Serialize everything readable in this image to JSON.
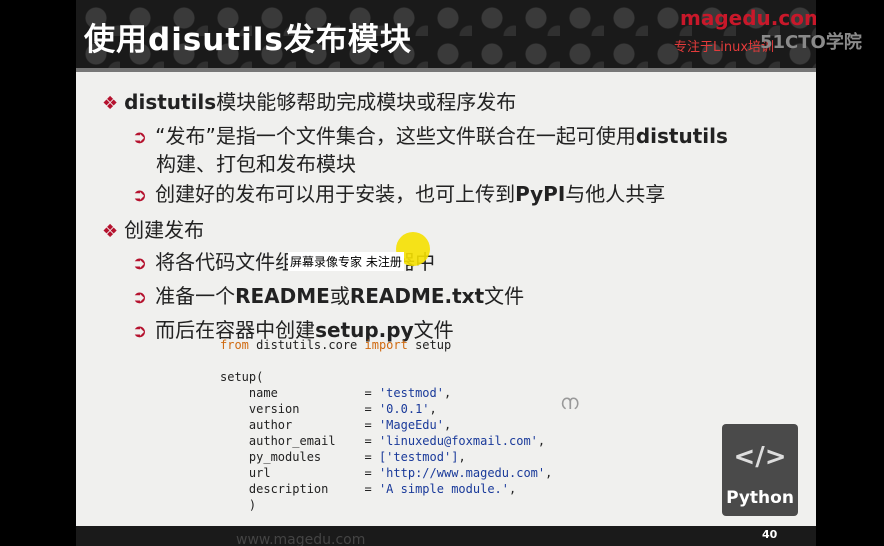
{
  "slide": {
    "title": "使用disutils发布模块",
    "logo": "magedu.com",
    "logo_tagline": "专注于Linux培训",
    "watermark_51cto": "51CTO学院",
    "page_number": "40",
    "footer_url": "www.magedu.com"
  },
  "bullets": [
    {
      "level": 1,
      "parts": [
        {
          "t": "distutils",
          "bold": true
        },
        {
          "t": "模块能够帮助完成模块或程序发布"
        }
      ]
    },
    {
      "level": 2,
      "parts": [
        {
          "t": "“发布”是指一个文件集合，这些文件联合在一起可使用"
        },
        {
          "t": "distutils",
          "bold": true
        }
      ]
    },
    {
      "level": 2,
      "continuation": true,
      "parts": [
        {
          "t": "构建、打包和发布模块"
        }
      ]
    },
    {
      "level": 2,
      "parts": [
        {
          "t": "创建好的发布可以用于安装，也可上传到"
        },
        {
          "t": "PyPI",
          "bold": true
        },
        {
          "t": "与他人共享"
        }
      ]
    },
    {
      "level": 1,
      "parts": [
        {
          "t": "创建发布"
        }
      ]
    },
    {
      "level": 2,
      "parts": [
        {
          "t": "将各代码文件组织到模块容器中"
        }
      ]
    },
    {
      "level": 2,
      "parts": [
        {
          "t": "准备一个"
        },
        {
          "t": "README",
          "bold": true
        },
        {
          "t": "或"
        },
        {
          "t": "README.txt",
          "bold": true
        },
        {
          "t": "文件"
        }
      ]
    },
    {
      "level": 2,
      "parts": [
        {
          "t": "而后在容器中创建"
        },
        {
          "t": "setup.py",
          "bold": true
        },
        {
          "t": "文件"
        }
      ]
    }
  ],
  "code": {
    "line1_kw1": "from",
    "line1_mid": " distutils.core ",
    "line1_kw2": "import",
    "line1_end": " setup",
    "setup_open": "setup(",
    "setup_close": "    )",
    "args": [
      {
        "key": "name",
        "value": "'testmod'",
        "tail": ","
      },
      {
        "key": "version",
        "value": "'0.0.1'",
        "tail": ","
      },
      {
        "key": "author",
        "value": "'MageEdu'",
        "tail": ","
      },
      {
        "key": "author_email",
        "value": "'linuxedu@foxmail.com'",
        "tail": ","
      },
      {
        "key": "py_modules",
        "value": "['testmod']",
        "tail": ","
      },
      {
        "key": "url",
        "value": "'http://www.magedu.com'",
        "tail": ","
      },
      {
        "key": "description",
        "value": "'A simple module.'",
        "tail": ","
      }
    ]
  },
  "overlay_watermark": "屏幕录像专家 未注册",
  "python_badge": {
    "code": "</>",
    "label": "Python"
  },
  "colors": {
    "bullet_mark": "#b5122e",
    "keyword": "#d06a10",
    "string": "#1a3a9a"
  }
}
